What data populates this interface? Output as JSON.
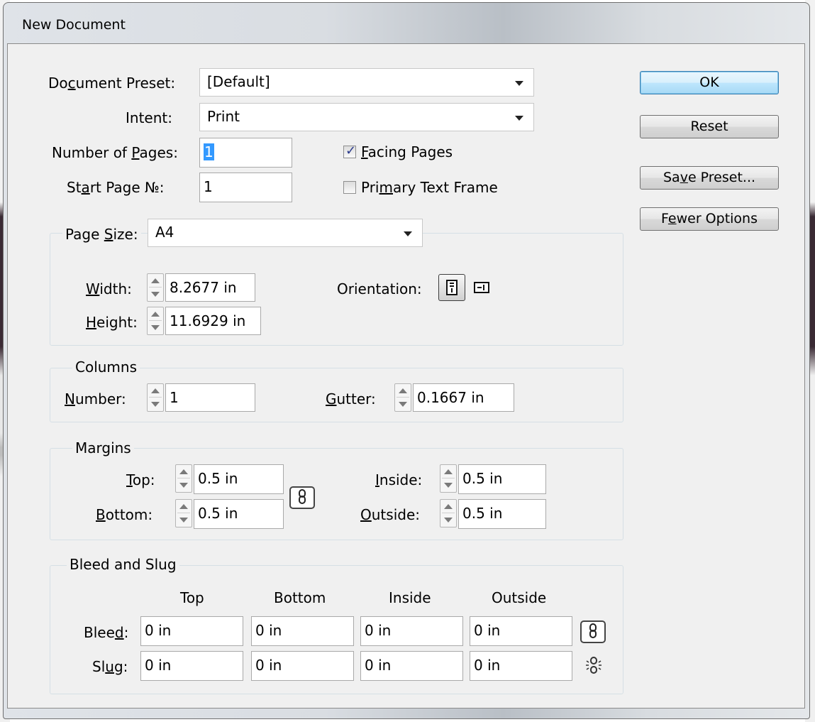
{
  "window": {
    "title": "New Document"
  },
  "buttons": {
    "ok": "OK",
    "reset": "Reset",
    "save_preset": "Save Preset...",
    "fewer_options": "Fewer Options"
  },
  "document": {
    "preset_label_pre": "Do",
    "preset_label_ul": "c",
    "preset_label_post": "ument Preset:",
    "preset_value": "[Default]",
    "intent_label": "Intent:",
    "intent_value": "Print",
    "pages_label_pre": "Number of ",
    "pages_label_ul": "P",
    "pages_label_post": "ages:",
    "pages_value": "1",
    "start_label_pre": "St",
    "start_label_ul": "a",
    "start_label_post": "rt Page №:",
    "start_value": "1",
    "facing_pre": "",
    "facing_ul": "F",
    "facing_post": "acing Pages",
    "facing_checked": true,
    "primary_pre": "Pri",
    "primary_ul": "m",
    "primary_post": "ary Text Frame",
    "primary_checked": false
  },
  "page_size": {
    "label_pre": "Page ",
    "label_ul": "S",
    "label_post": "ize:",
    "value": "A4",
    "width_ul": "W",
    "width_post": "idth:",
    "width_value": "8.2677 in",
    "height_ul": "H",
    "height_post": "eight:",
    "height_value": "11.6929 in",
    "orientation_label": "Orientation:"
  },
  "columns": {
    "legend": "Columns",
    "number_ul": "N",
    "number_post": "umber:",
    "number_value": "1",
    "gutter_ul": "G",
    "gutter_post": "utter:",
    "gutter_value": "0.1667 in"
  },
  "margins": {
    "legend": "Margins",
    "top_ul": "T",
    "top_post": "op:",
    "top_value": "0.5 in",
    "bottom_ul": "B",
    "bottom_post": "ottom:",
    "bottom_value": "0.5 in",
    "inside_ul": "I",
    "inside_post": "nside:",
    "inside_value": "0.5 in",
    "outside_ul": "O",
    "outside_post": "utside:",
    "outside_value": "0.5 in"
  },
  "bleed_slug": {
    "legend": "Bleed and Slug",
    "headers": [
      "Top",
      "Bottom",
      "Inside",
      "Outside"
    ],
    "bleed_pre": "Blee",
    "bleed_ul": "d",
    "bleed_post": ":",
    "bleed_values": [
      "0 in",
      "0 in",
      "0 in",
      "0 in"
    ],
    "slug_pre": "Sl",
    "slug_ul": "u",
    "slug_post": "g:",
    "slug_values": [
      "0 in",
      "0 in",
      "0 in",
      "0 in"
    ]
  }
}
